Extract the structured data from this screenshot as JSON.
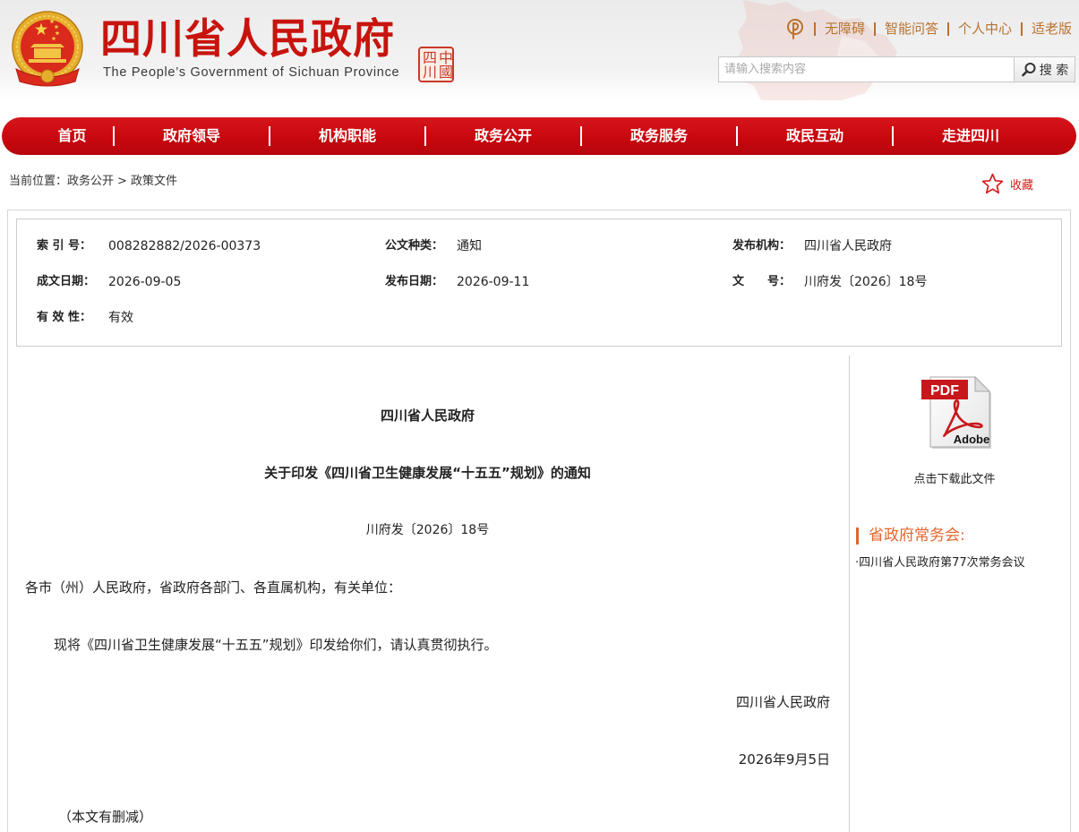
{
  "colors": {
    "brand_red": "#c8140e",
    "nav_red": "#c9070e",
    "link_brown": "#b9722f",
    "accent_orange": "#e5642b",
    "favorite_red": "#d61a1a"
  },
  "header": {
    "emblem_icon": "national-emblem-icon",
    "title": "四川省人民政府",
    "subtitle": "The People’s Government of Sichuan Province",
    "seal_text": "中國四川"
  },
  "top_links": {
    "icon": "pin-icon",
    "items": [
      "无障碍",
      "智能问答",
      "个人中心",
      "适老版"
    ]
  },
  "search": {
    "placeholder": "请输入搜索内容",
    "button_label": "搜 索",
    "icon": "search-icon"
  },
  "nav": {
    "items": [
      "首页",
      "政府领导",
      "机构职能",
      "政务公开",
      "政务服务",
      "政民互动",
      "走进四川"
    ]
  },
  "breadcrumb": {
    "prefix": "当前位置：",
    "separator": ">",
    "items": [
      "政务公开",
      "政策文件"
    ]
  },
  "favorite": {
    "icon": "star-icon",
    "label": "收藏"
  },
  "meta": {
    "rows": [
      [
        {
          "label": "索 引 号：",
          "value": "008282882/2026-00373"
        },
        {
          "label": "公文种类：",
          "value": "通知"
        },
        {
          "label": "发布机构：",
          "value": "四川省人民政府"
        }
      ],
      [
        {
          "label": "成文日期：",
          "value": "2026-09-05"
        },
        {
          "label": "发布日期：",
          "value": "2026-09-11"
        },
        {
          "label": "文　　号：",
          "value": "川府发〔2026〕18号"
        }
      ],
      [
        {
          "label": "有 效 性：",
          "value": "有效"
        }
      ]
    ]
  },
  "article": {
    "issuer": "四川省人民政府",
    "title": "关于印发《四川省卫生健康发展“十五五”规划》的通知",
    "doc_number": "川府发〔2026〕18号",
    "salutation": "各市（州）人民政府，省政府各部门、各直属机构，有关单位：",
    "body": "现将《四川省卫生健康发展“十五五”规划》印发给你们，请认真贯彻执行。",
    "signature": "四川省人民政府",
    "date": "2026年9月5日",
    "note": "（本文有删减）"
  },
  "sidebar": {
    "pdf": {
      "icon": "pdf-file-icon",
      "badge": "PDF",
      "brand": "Adobe",
      "download_label": "点击下载此文件"
    },
    "section": {
      "heading": "省政府常务会:",
      "items": [
        "·四川省人民政府第77次常务会议"
      ]
    }
  }
}
